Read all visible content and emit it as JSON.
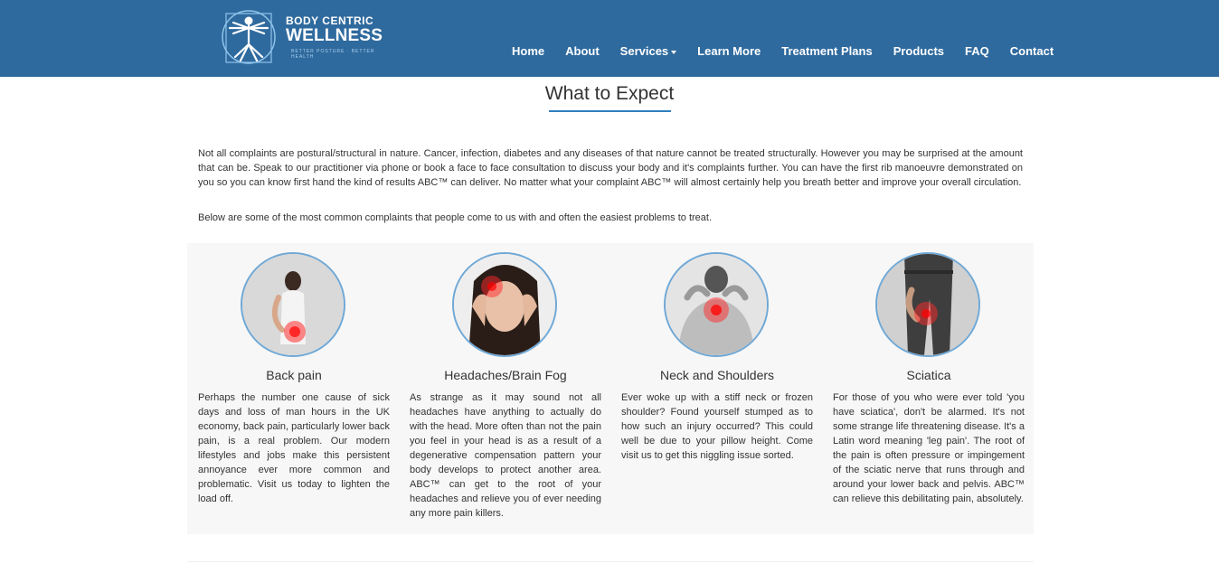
{
  "header": {
    "logo": {
      "line1": "BODY CENTRIC",
      "line2": "WELLNESS",
      "tagline": "BETTER POSTURE · BETTER HEALTH"
    },
    "nav": [
      {
        "label": "Home"
      },
      {
        "label": "About"
      },
      {
        "label": "Services"
      },
      {
        "label": "Learn More"
      },
      {
        "label": "Treatment Plans"
      },
      {
        "label": "Products"
      },
      {
        "label": "FAQ"
      },
      {
        "label": "Contact"
      }
    ]
  },
  "main": {
    "title": "What to Expect",
    "intro_paragraph": "Not all complaints are postural/structural in nature. Cancer, infection, diabetes and any diseases of that nature cannot be treated structurally. However you may be surprised at the amount that can be. Speak to our practitioner via phone or book a face to face consultation to discuss your body and it's complaints further. You can have the first rib manoeuvre demonstrated on you so you can know first hand the kind of results ABC™ can deliver. No matter what your complaint ABC™ will almost certainly help you breath better and improve your overall circulation.",
    "intro_paragraph_2": "Below are some of the most common complaints that people come to us with and often the easiest problems to treat.",
    "complaints": [
      {
        "title": "Back pain",
        "text": "Perhaps the number one cause of sick days and loss of man hours in the UK economy, back pain, particularly lower back pain, is a real problem. Our modern lifestyles and jobs make this persistent annoyance ever more common and problematic. Visit us today to lighten the load off."
      },
      {
        "title": "Headaches/Brain Fog",
        "text": "As strange as it may sound not all headaches have anything to actually do with the head. More often than not the pain you feel in your head is as a result of a degenerative compensation pattern your body develops to protect another area. ABC™ can get to the root of your headaches and relieve you of ever needing any more pain killers."
      },
      {
        "title": "Neck and Shoulders",
        "text": "Ever woke up with a stiff neck or frozen shoulder? Found yourself stumped as to how such an injury occurred? This could well be due to your pillow height. Come visit us to get this niggling issue sorted."
      },
      {
        "title": "Sciatica",
        "text": "For those of you who were ever told 'you have sciatica', don't be alarmed. It's not some strange life threatening disease. It's a Latin word meaning 'leg pain'. The root of the pain is often pressure or impingement of the sciatic nerve that runs through and around your lower back and pelvis. ABC™ can relieve this debilitating pain, absolutely."
      }
    ]
  },
  "colors": {
    "navbar": "#2f6a9e",
    "accent": "#2f7fc1",
    "panel_bg": "#f7f7f7",
    "text": "#333333"
  }
}
